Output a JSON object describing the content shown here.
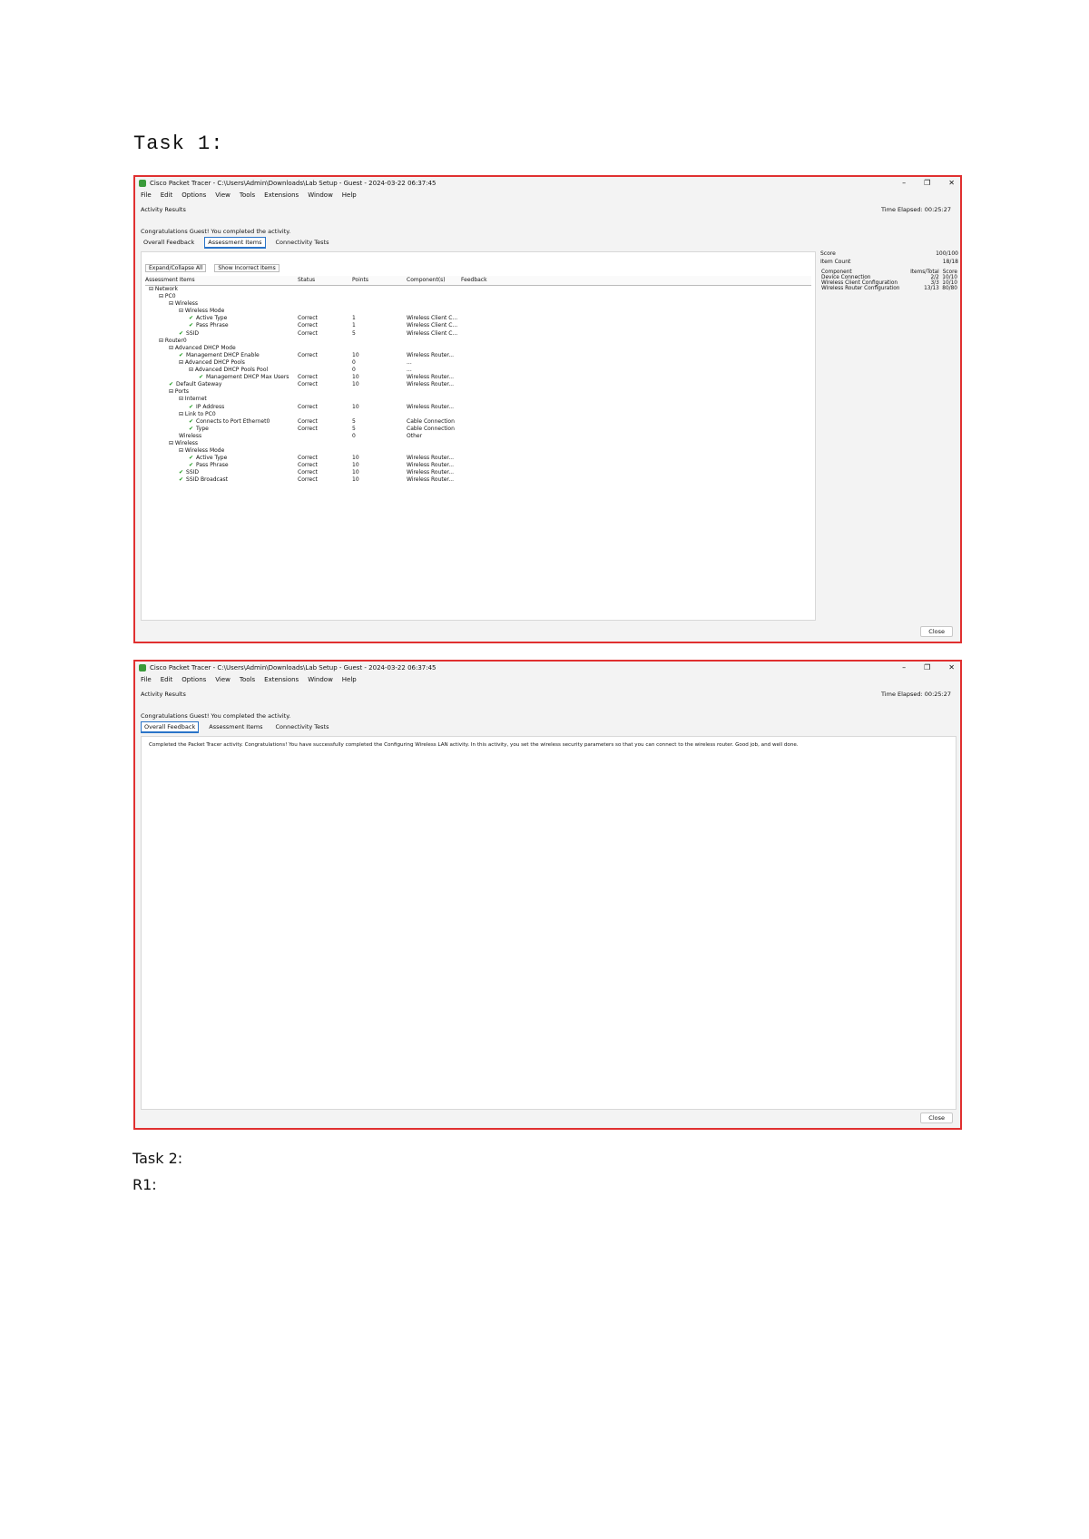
{
  "doc": {
    "task1_heading": "Task 1:",
    "task2_heading": "Task 2:",
    "r1_label": "R1:"
  },
  "shot1": {
    "title": "Cisco Packet Tracer - C:\\Users\\Admin\\Downloads\\Lab Setup - Guest - 2024-03-22 06:37:45",
    "win_controls": [
      "–",
      "❐",
      "✕"
    ],
    "menu": [
      "File",
      "Edit",
      "Options",
      "View",
      "Tools",
      "Extensions",
      "Window",
      "Help"
    ],
    "activity_results": "Activity Results",
    "time_elapsed": "Time Elapsed: 00:25:27",
    "congrats": "Congratulations Guest! You completed the activity.",
    "tabs": [
      "Overall Feedback",
      "Assessment Items",
      "Connectivity Tests"
    ],
    "buttons": [
      "Expand/Collapse All",
      "Show Incorrect Items"
    ],
    "columns": [
      "Assessment Items",
      "Status",
      "Points",
      "Component(s)",
      "Feedback"
    ],
    "rows": [
      {
        "indent": 0,
        "check": false,
        "label": "⊟ Network",
        "status": "",
        "points": "",
        "component": ""
      },
      {
        "indent": 1,
        "check": false,
        "label": "⊟ PC0",
        "status": "",
        "points": "",
        "component": ""
      },
      {
        "indent": 2,
        "check": false,
        "label": "⊟ Wireless",
        "status": "",
        "points": "",
        "component": ""
      },
      {
        "indent": 3,
        "check": false,
        "label": "⊟ Wireless Mode",
        "status": "",
        "points": "",
        "component": ""
      },
      {
        "indent": 4,
        "check": true,
        "label": "Active Type",
        "status": "Correct",
        "points": "1",
        "component": "Wireless Client C..."
      },
      {
        "indent": 4,
        "check": true,
        "label": "Pass Phrase",
        "status": "Correct",
        "points": "1",
        "component": "Wireless Client C..."
      },
      {
        "indent": 3,
        "check": true,
        "label": "SSID",
        "status": "Correct",
        "points": "5",
        "component": "Wireless Client C..."
      },
      {
        "indent": 1,
        "check": false,
        "label": "⊟ Router0",
        "status": "",
        "points": "",
        "component": ""
      },
      {
        "indent": 2,
        "check": false,
        "label": "⊟ Advanced DHCP Mode",
        "status": "",
        "points": "",
        "component": ""
      },
      {
        "indent": 3,
        "check": true,
        "label": "Management DHCP Enable",
        "status": "Correct",
        "points": "10",
        "component": "Wireless Router..."
      },
      {
        "indent": 3,
        "check": false,
        "label": "⊟ Advanced DHCP Pools",
        "status": "",
        "points": "0",
        "component": "..."
      },
      {
        "indent": 4,
        "check": false,
        "label": "⊟ Advanced DHCP Pools Pool",
        "status": "",
        "points": "0",
        "component": "..."
      },
      {
        "indent": 5,
        "check": true,
        "label": "Management DHCP Max Users",
        "status": "Correct",
        "points": "10",
        "component": "Wireless Router..."
      },
      {
        "indent": 2,
        "check": true,
        "label": "Default Gateway",
        "status": "Correct",
        "points": "10",
        "component": "Wireless Router..."
      },
      {
        "indent": 2,
        "check": false,
        "label": "⊟ Ports",
        "status": "",
        "points": "",
        "component": ""
      },
      {
        "indent": 3,
        "check": false,
        "label": "⊟ Internet",
        "status": "",
        "points": "",
        "component": ""
      },
      {
        "indent": 4,
        "check": true,
        "label": "IP Address",
        "status": "Correct",
        "points": "10",
        "component": "Wireless Router..."
      },
      {
        "indent": 3,
        "check": false,
        "label": "⊟ Link to PC0",
        "status": "",
        "points": "",
        "component": ""
      },
      {
        "indent": 4,
        "check": true,
        "label": "Connects to Port Ethernet0",
        "status": "Correct",
        "points": "5",
        "component": "Cable Connection"
      },
      {
        "indent": 4,
        "check": true,
        "label": "Type",
        "status": "Correct",
        "points": "5",
        "component": "Cable Connection"
      },
      {
        "indent": 3,
        "check": false,
        "label": "Wireless",
        "status": "",
        "points": "0",
        "component": "Other"
      },
      {
        "indent": 2,
        "check": false,
        "label": "⊟ Wireless",
        "status": "",
        "points": "",
        "component": ""
      },
      {
        "indent": 3,
        "check": false,
        "label": "⊟ Wireless Mode",
        "status": "",
        "points": "",
        "component": ""
      },
      {
        "indent": 4,
        "check": true,
        "label": "Active Type",
        "status": "Correct",
        "points": "10",
        "component": "Wireless Router..."
      },
      {
        "indent": 4,
        "check": true,
        "label": "Pass Phrase",
        "status": "Correct",
        "points": "10",
        "component": "Wireless Router..."
      },
      {
        "indent": 3,
        "check": true,
        "label": "SSID",
        "status": "Correct",
        "points": "10",
        "component": "Wireless Router..."
      },
      {
        "indent": 3,
        "check": true,
        "label": "SSID Broadcast",
        "status": "Correct",
        "points": "10",
        "component": "Wireless Router..."
      }
    ],
    "side": {
      "score_label": "Score",
      "score_value": "100/100",
      "item_count_label": "Item Count",
      "item_count_value": "18/18",
      "headers": [
        "Component",
        "Items/Total",
        "Score"
      ],
      "rows": [
        [
          "Device Connection",
          "2/2",
          "10/10"
        ],
        [
          "Wireless Client Configuration",
          "3/3",
          "10/10"
        ],
        [
          "Wireless Router Configuration",
          "13/13",
          "80/80"
        ]
      ]
    },
    "close_label": "Close"
  },
  "shot2": {
    "title": "Cisco Packet Tracer - C:\\Users\\Admin\\Downloads\\Lab Setup - Guest - 2024-03-22 06:37:45",
    "win_controls": [
      "–",
      "❐",
      "✕"
    ],
    "menu": [
      "File",
      "Edit",
      "Options",
      "View",
      "Tools",
      "Extensions",
      "Window",
      "Help"
    ],
    "activity_results": "Activity Results",
    "time_elapsed": "Time Elapsed: 00:25:27",
    "congrats": "Congratulations Guest! You completed the activity.",
    "tabs": [
      "Overall Feedback",
      "Assessment Items",
      "Connectivity Tests"
    ],
    "feedback": "Completed the Packet Tracer activity. Congratulations! You have successfully completed the Configuring Wireless LAN activity. In this activity, you set the wireless security parameters so that you can connect to the wireless router. Good job, and well done.",
    "close_label": "Close"
  }
}
